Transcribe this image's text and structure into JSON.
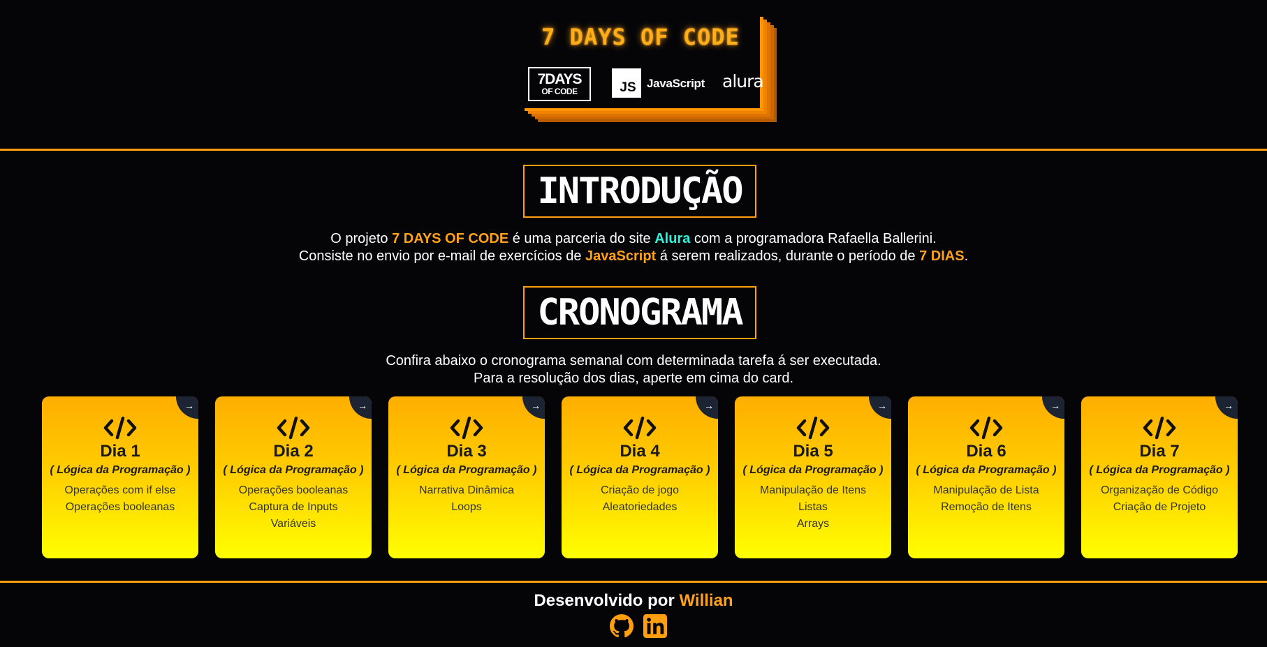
{
  "header": {
    "banner_title": "7 DAYS OF CODE",
    "logo_7days_line1": "7DAYS",
    "logo_7days_line2": "OF CODE",
    "logo_js": "JS",
    "logo_js_text": "JavaScript",
    "logo_alura": "alura"
  },
  "intro": {
    "title": "INTRODUÇÃO",
    "line1": {
      "t1": "O projeto ",
      "h1": "7 DAYS OF CODE",
      "t2": " é uma parceria do site ",
      "h2": "Alura",
      "t3": " com a programadora Rafaella Ballerini."
    },
    "line2": {
      "t1": "Consiste no envio por e-mail de exercícios de ",
      "h1": "JavaScript",
      "t2": " á serem realizados, durante o período de ",
      "h2": "7 DIAS",
      "t3": "."
    }
  },
  "schedule": {
    "title": "CRONOGRAMA",
    "line1": "Confira abaixo o cronograma semanal com determinada tarefa á ser executada.",
    "line2": "Para a resolução dos dias, aperte em cima do card.",
    "corner_arrow": "→",
    "cards": [
      {
        "day": "Dia 1",
        "subtitle": "( Lógica da Programação )",
        "topics": [
          "Operações com if else",
          "Operações booleanas",
          ""
        ]
      },
      {
        "day": "Dia 2",
        "subtitle": "( Lógica da Programação )",
        "topics": [
          "Operações booleanas",
          "Captura de Inputs",
          "Variáveis"
        ]
      },
      {
        "day": "Dia 3",
        "subtitle": "( Lógica da Programação )",
        "topics": [
          "Narrativa Dinâmica",
          "Loops",
          ""
        ]
      },
      {
        "day": "Dia 4",
        "subtitle": "( Lógica da Programação )",
        "topics": [
          "Criação de jogo",
          "Aleatoriedades",
          ""
        ]
      },
      {
        "day": "Dia 5",
        "subtitle": "( Lógica da Programação )",
        "topics": [
          "Manipulação de Itens",
          "Listas",
          "Arrays"
        ]
      },
      {
        "day": "Dia 6",
        "subtitle": "( Lógica da Programação )",
        "topics": [
          "Manipulação de Lista",
          "Remoção de Itens",
          ""
        ]
      },
      {
        "day": "Dia 7",
        "subtitle": "( Lógica da Programação )",
        "topics": [
          "Organização de Código",
          "Criação de Projeto",
          ""
        ]
      }
    ]
  },
  "footer": {
    "text": "Desenvolvido por ",
    "author": "Willian",
    "icons": [
      "github-icon",
      "linkedin-icon"
    ]
  },
  "colors": {
    "accent": "#ff9f0f",
    "highlight_cyan": "#2ef2dc",
    "background": "#050508",
    "card_gradient_top": "#ffae00",
    "card_gradient_bottom": "#ffff00"
  }
}
